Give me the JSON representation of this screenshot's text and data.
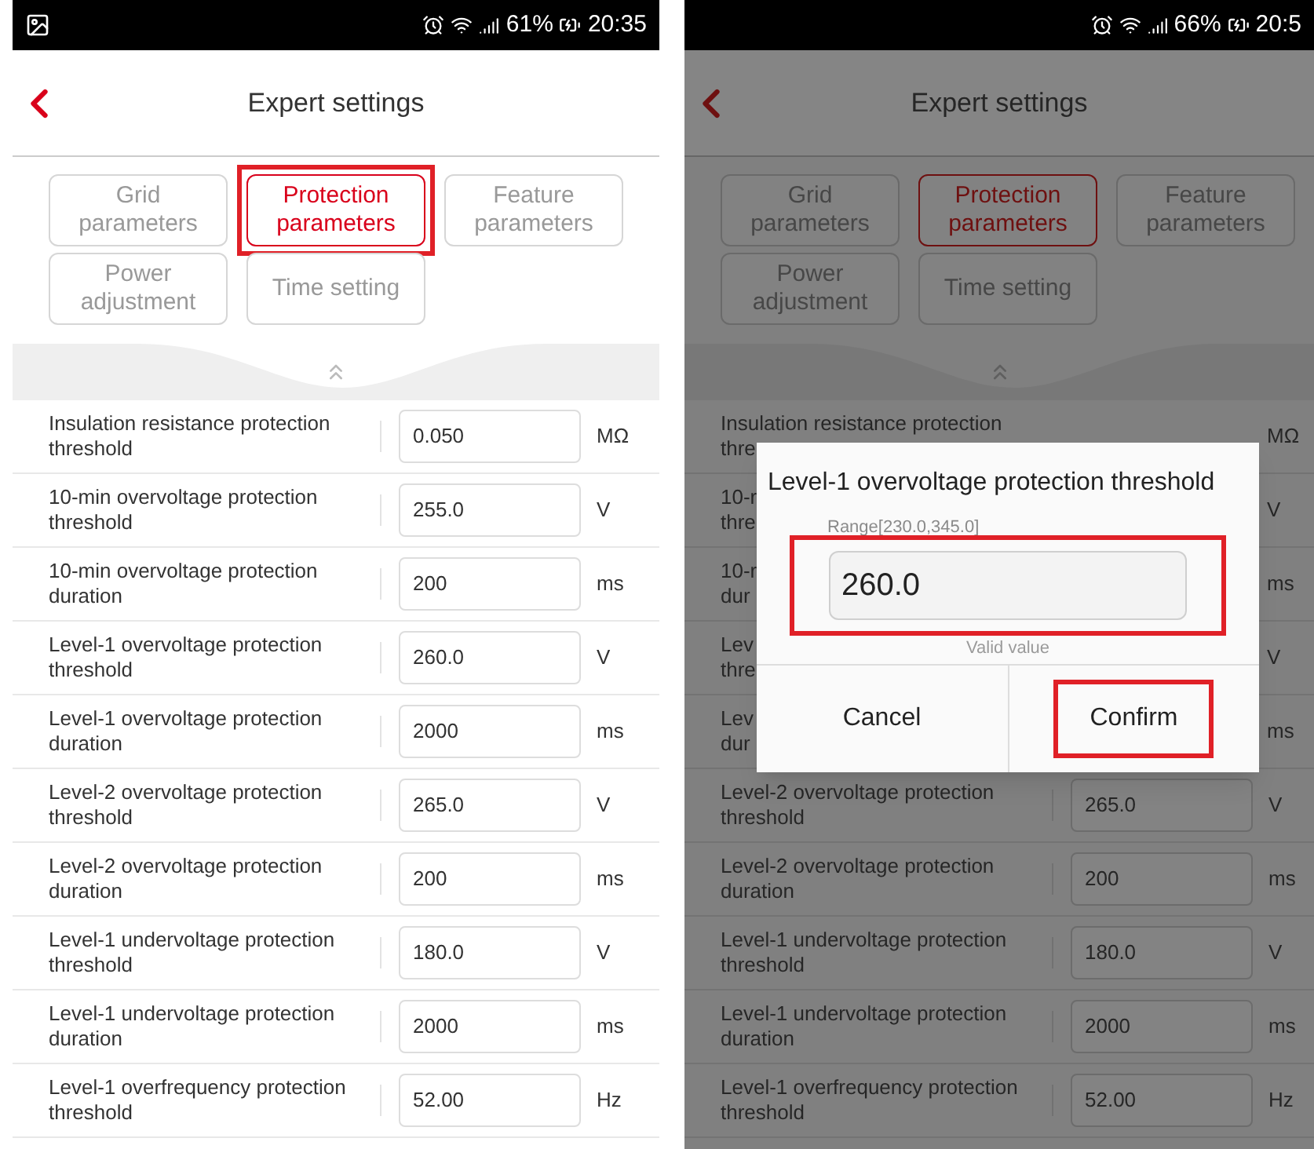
{
  "panels": [
    {
      "dimmed": false,
      "status_bar": {
        "notification_icon": true,
        "battery": "61%",
        "time": "20:35"
      },
      "header": {
        "title": "Expert settings"
      },
      "tabs": [
        {
          "label": "Grid parameters",
          "selected": false,
          "highlighted": false
        },
        {
          "label": "Protection parameters",
          "selected": true,
          "highlighted": true
        },
        {
          "label": "Feature parameters",
          "selected": false,
          "highlighted": false
        },
        {
          "label": "Power adjustment",
          "selected": false,
          "highlighted": false
        },
        {
          "label": "Time setting",
          "selected": false,
          "highlighted": false
        }
      ],
      "rows": [
        {
          "kind": "full",
          "label": "Insulation resistance protection threshold",
          "value": "0.050",
          "unit": "MΩ"
        },
        {
          "kind": "full",
          "label": "10-min overvoltage protection threshold",
          "value": "255.0",
          "unit": "V"
        },
        {
          "kind": "full",
          "label": "10-min overvoltage protection duration",
          "value": "200",
          "unit": "ms"
        },
        {
          "kind": "full",
          "label": "Level-1 overvoltage protection threshold",
          "value": "260.0",
          "unit": "V"
        },
        {
          "kind": "full",
          "label": "Level-1 overvoltage protection duration",
          "value": "2000",
          "unit": "ms"
        },
        {
          "kind": "full",
          "label": "Level-2 overvoltage protection threshold",
          "value": "265.0",
          "unit": "V"
        },
        {
          "kind": "full",
          "label": "Level-2 overvoltage protection duration",
          "value": "200",
          "unit": "ms"
        },
        {
          "kind": "full",
          "label": "Level-1 undervoltage protection threshold",
          "value": "180.0",
          "unit": "V"
        },
        {
          "kind": "full",
          "label": "Level-1 undervoltage protection duration",
          "value": "2000",
          "unit": "ms"
        },
        {
          "kind": "full",
          "label": "Level-1 overfrequency protection threshold",
          "value": "52.00",
          "unit": "Hz"
        }
      ]
    },
    {
      "dimmed": true,
      "status_bar": {
        "notification_icon": false,
        "battery": "66%",
        "time": "20:5"
      },
      "header": {
        "title": "Expert settings"
      },
      "tabs": [
        {
          "label": "Grid parameters",
          "selected": false,
          "highlighted": false
        },
        {
          "label": "Protection parameters",
          "selected": true,
          "highlighted": false
        },
        {
          "label": "Feature parameters",
          "selected": false,
          "highlighted": false
        },
        {
          "label": "Power adjustment",
          "selected": false,
          "highlighted": false
        },
        {
          "label": "Time setting",
          "selected": false,
          "highlighted": false
        }
      ],
      "rows": [
        {
          "kind": "covered",
          "lines": [
            "Insulation resistance protection",
            "thre"
          ],
          "unit": "MΩ"
        },
        {
          "kind": "covered",
          "lines": [
            "10-r",
            "thre"
          ],
          "unit": "V"
        },
        {
          "kind": "covered",
          "lines": [
            "10-r",
            "dur"
          ],
          "unit": "ms"
        },
        {
          "kind": "covered",
          "lines": [
            "Lev",
            "thre"
          ],
          "unit": "V"
        },
        {
          "kind": "covered",
          "lines": [
            "Lev",
            "dur"
          ],
          "unit": "ms"
        },
        {
          "kind": "full",
          "label": "Level-2 overvoltage protection threshold",
          "value": "265.0",
          "unit": "V"
        },
        {
          "kind": "full",
          "label": "Level-2 overvoltage protection duration",
          "value": "200",
          "unit": "ms"
        },
        {
          "kind": "full",
          "label": "Level-1 undervoltage protection threshold",
          "value": "180.0",
          "unit": "V"
        },
        {
          "kind": "full",
          "label": "Level-1 undervoltage protection duration",
          "value": "2000",
          "unit": "ms"
        },
        {
          "kind": "full",
          "label": "Level-1 overfrequency protection threshold",
          "value": "52.00",
          "unit": "Hz"
        }
      ],
      "dialog": {
        "title": "Level-1 overvoltage protection threshold",
        "range": "Range[230.0,345.0]",
        "value": "260.0",
        "field_highlighted": true,
        "hint": "Valid value",
        "buttons": [
          {
            "label": "Cancel",
            "highlighted": false
          },
          {
            "label": "Confirm",
            "highlighted": true
          }
        ]
      }
    }
  ]
}
